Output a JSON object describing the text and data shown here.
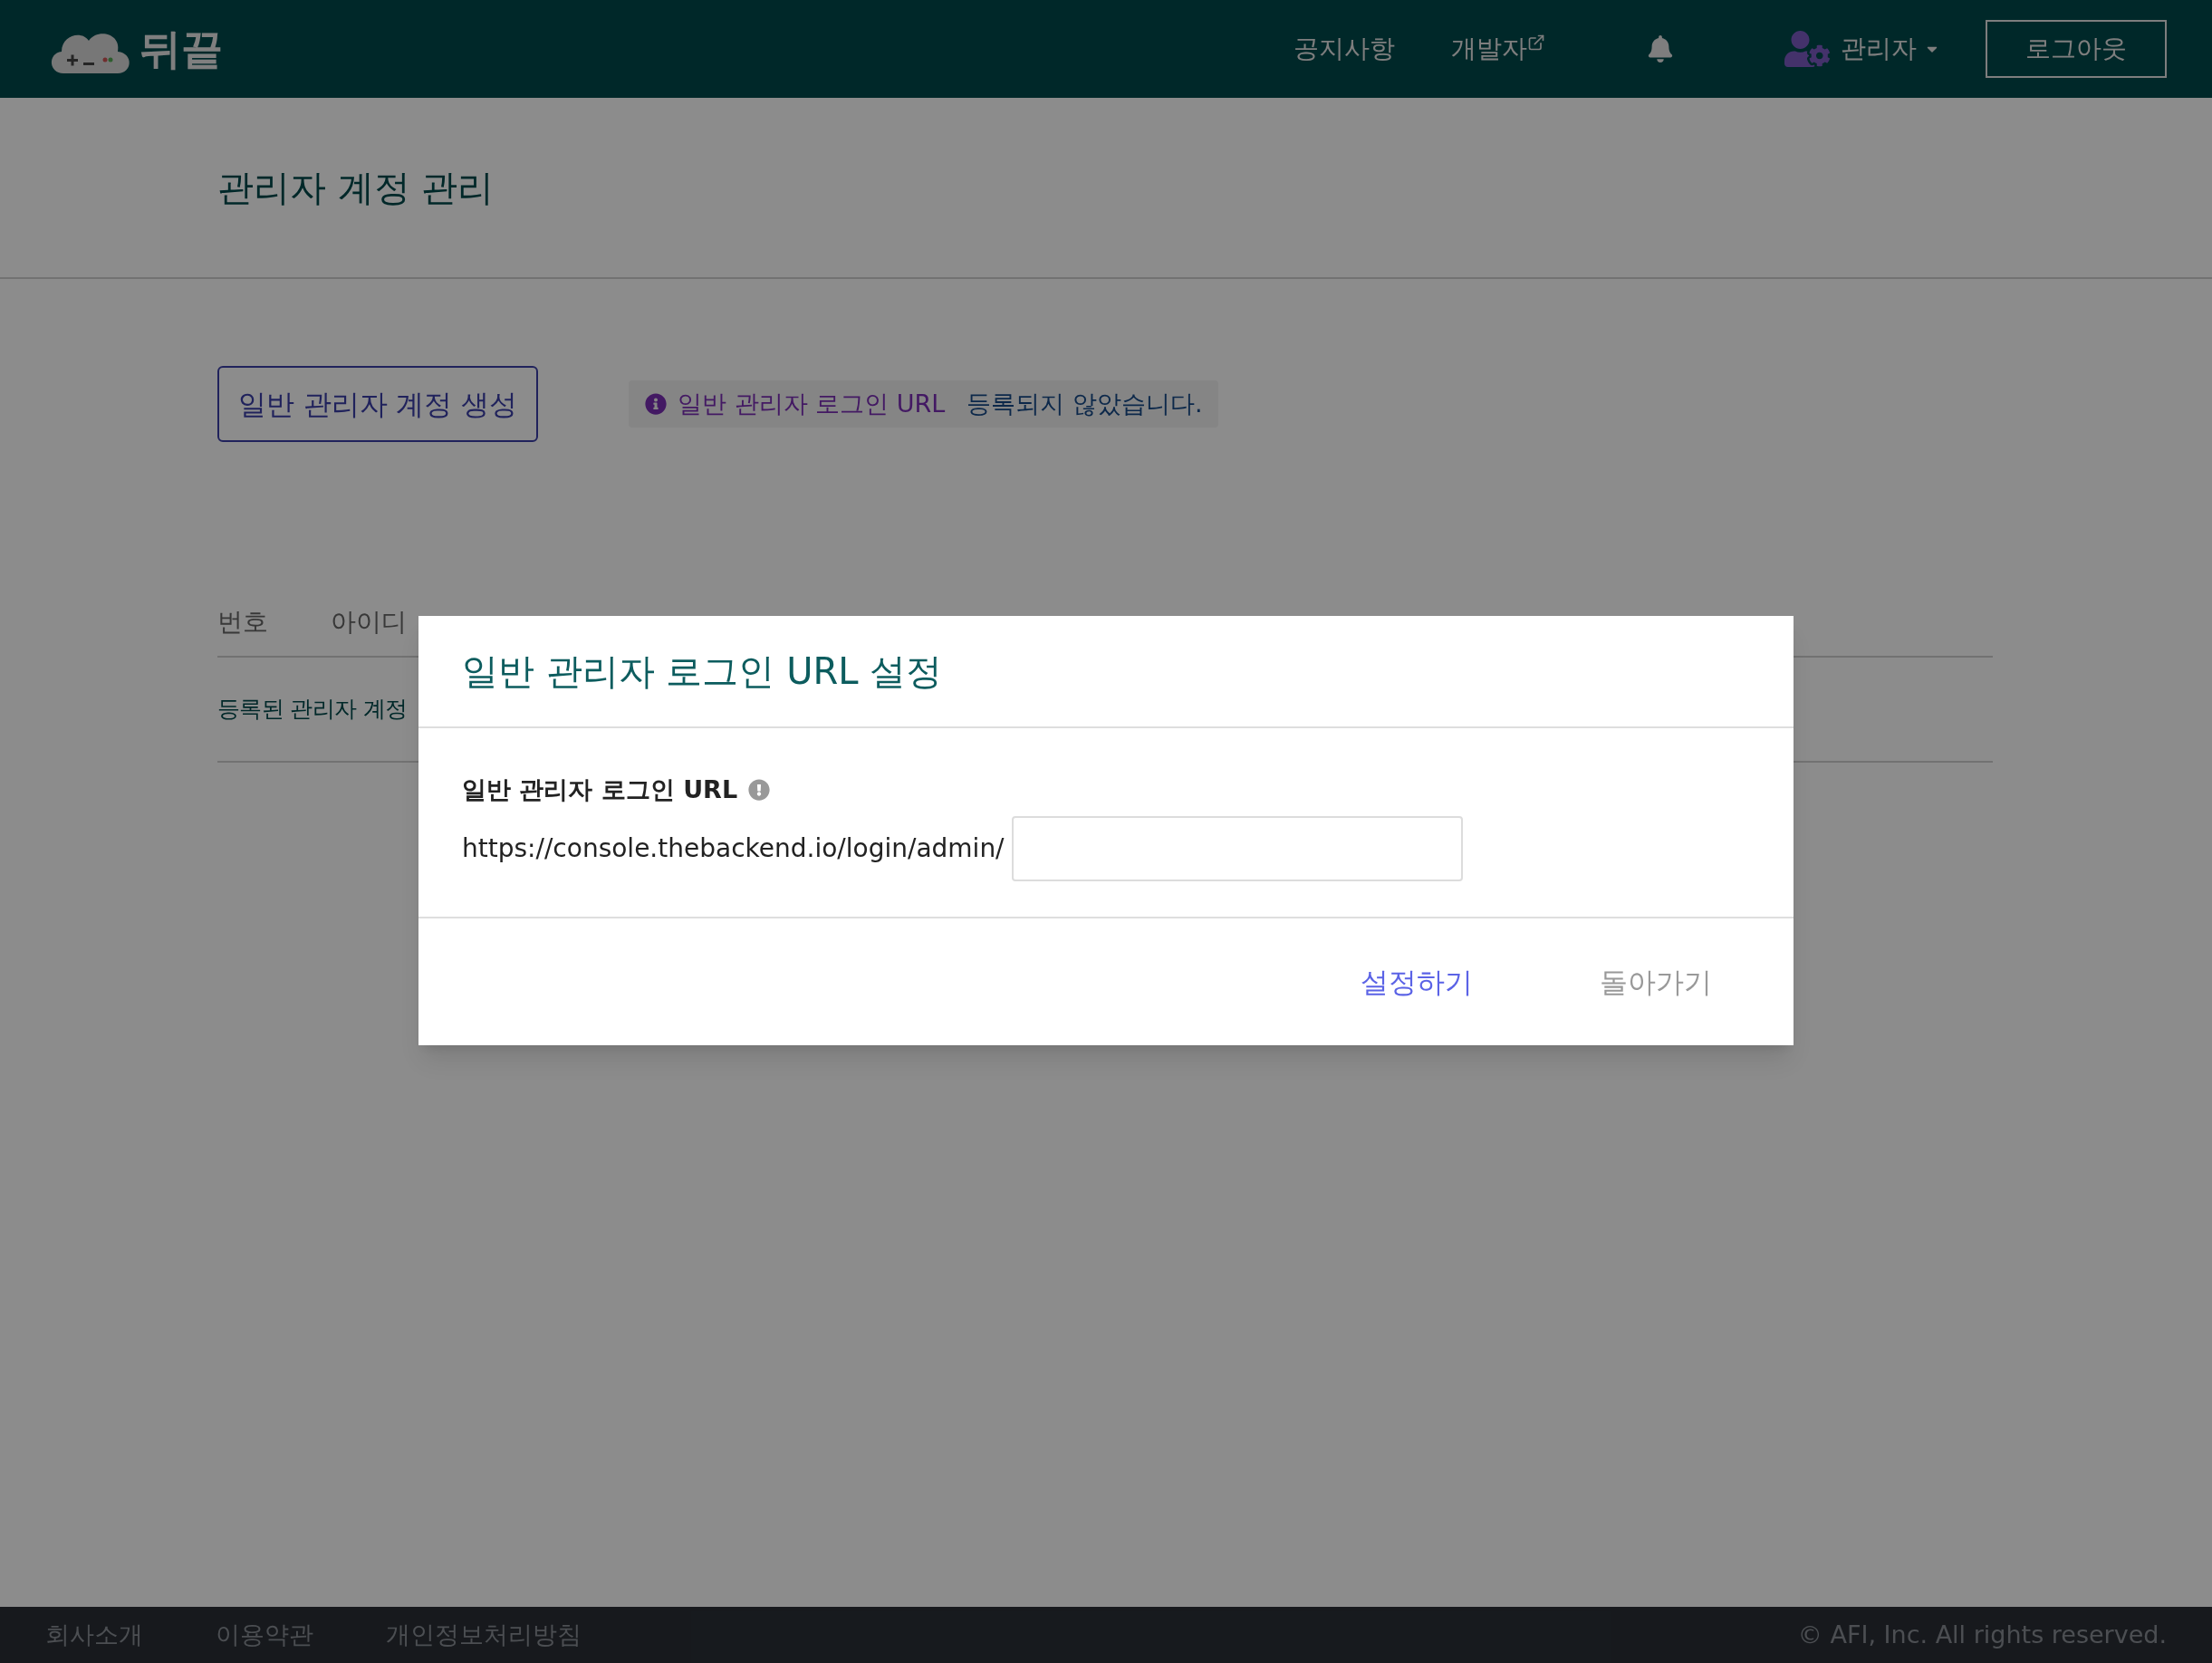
{
  "header": {
    "logo": "뒤끝",
    "nav": [
      {
        "label": "공지사항",
        "external": false
      },
      {
        "label": "개발자",
        "external": true
      }
    ],
    "user": "관리자",
    "logout": "로그아웃"
  },
  "page": {
    "title": "관리자 계정 관리",
    "create_button": "일반 관리자 계정 생성",
    "notice": {
      "highlight": "일반 관리자 로그인 URL",
      "text": "등록되지 않았습니다."
    }
  },
  "table": {
    "columns": [
      "번호",
      "아이디"
    ],
    "empty_message": "등록된 관리자 계정"
  },
  "dialog": {
    "title": "일반 관리자 로그인 URL 설정",
    "field_label": "일반 관리자 로그인 URL",
    "url_prefix": "https://console.thebackend.io/login/admin/",
    "buttons": [
      {
        "label": "설정하기",
        "kind": "primary"
      },
      {
        "label": "돌아가기",
        "kind": "secondary"
      }
    ]
  },
  "footer": {
    "links": [
      "회사소개",
      "이용약관",
      "개인정보처리방침"
    ],
    "copyright": "© AFI, Inc. All rights reserved."
  }
}
